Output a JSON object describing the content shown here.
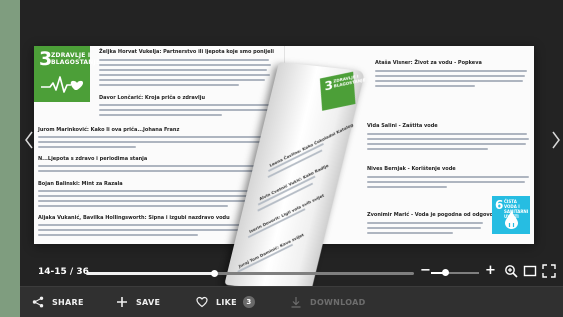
{
  "viewer": {
    "page_counter": "14-15 / 36",
    "progress_fraction": 0.39,
    "zoom_fraction": 0.3
  },
  "left_page": {
    "sdg_badge": {
      "number": "3",
      "title": "ZDRAVLJE I\nBLAGOSTANJE",
      "color": "#4c9f38"
    },
    "headings": [
      "Željka Horvat Vukelja: Partnerstvo ili ljepota koje smo ponijeli",
      "Davor Lončarić: Kroja priča o zdravlju",
      "Jurom Marinković: Kako li ova priča...Johana Franz",
      "N...Ljepota s zdravo i periodima stanja",
      "Bojan Balinski: Mint za Razala",
      "Aljaka Vukanić, Bavilka Hollingsworth: Sipna i izgubi nazdravo vodu"
    ]
  },
  "right_page": {
    "headings": [
      "Ataša Visner: Život za vodu - Popkeva",
      "Vida Salini - Zaštita vode",
      "Nives Bernjak - Korištenje vode",
      "Zvonimir Marić - Voda je pogodna od odgovornog vode"
    ],
    "sdg_badge": {
      "number": "6",
      "title": "ČISTA VODA I\nSANITARNI UVJETI",
      "color": "#26bde2"
    }
  },
  "page_curl": {
    "sdg_badge": {
      "number": "3",
      "title": "ZDRAVLJE I\nBLAGOSTANJE"
    },
    "headings": [
      "Leona Čavlina: Kako Čokoladni Katalog",
      "Alvin Cvetnić Vukić: Kako Radlje",
      "Iserin Dovorit: Ligli vola svih svijet",
      "Juraj Tom Daminić: Kava svijet"
    ]
  },
  "actions": {
    "share": "SHARE",
    "save": "SAVE",
    "like": "LIKE",
    "like_count": "3",
    "download": "DOWNLOAD"
  },
  "colors": {
    "app_bg": "#2f2f2f",
    "viewer_bg": "#232323",
    "outer_bg": "#7f9d7f",
    "sdg3_green": "#4c9f38",
    "sdg6_blue": "#26bde2"
  },
  "icons": {
    "share": "share-icon",
    "save": "plus-icon",
    "like": "heart-icon",
    "download": "download-icon",
    "zoom_in": "zoom-in-icon",
    "single_page": "single-page-icon",
    "fullscreen": "fullscreen-icon",
    "prev": "chevron-left-icon",
    "next": "chevron-right-icon"
  }
}
